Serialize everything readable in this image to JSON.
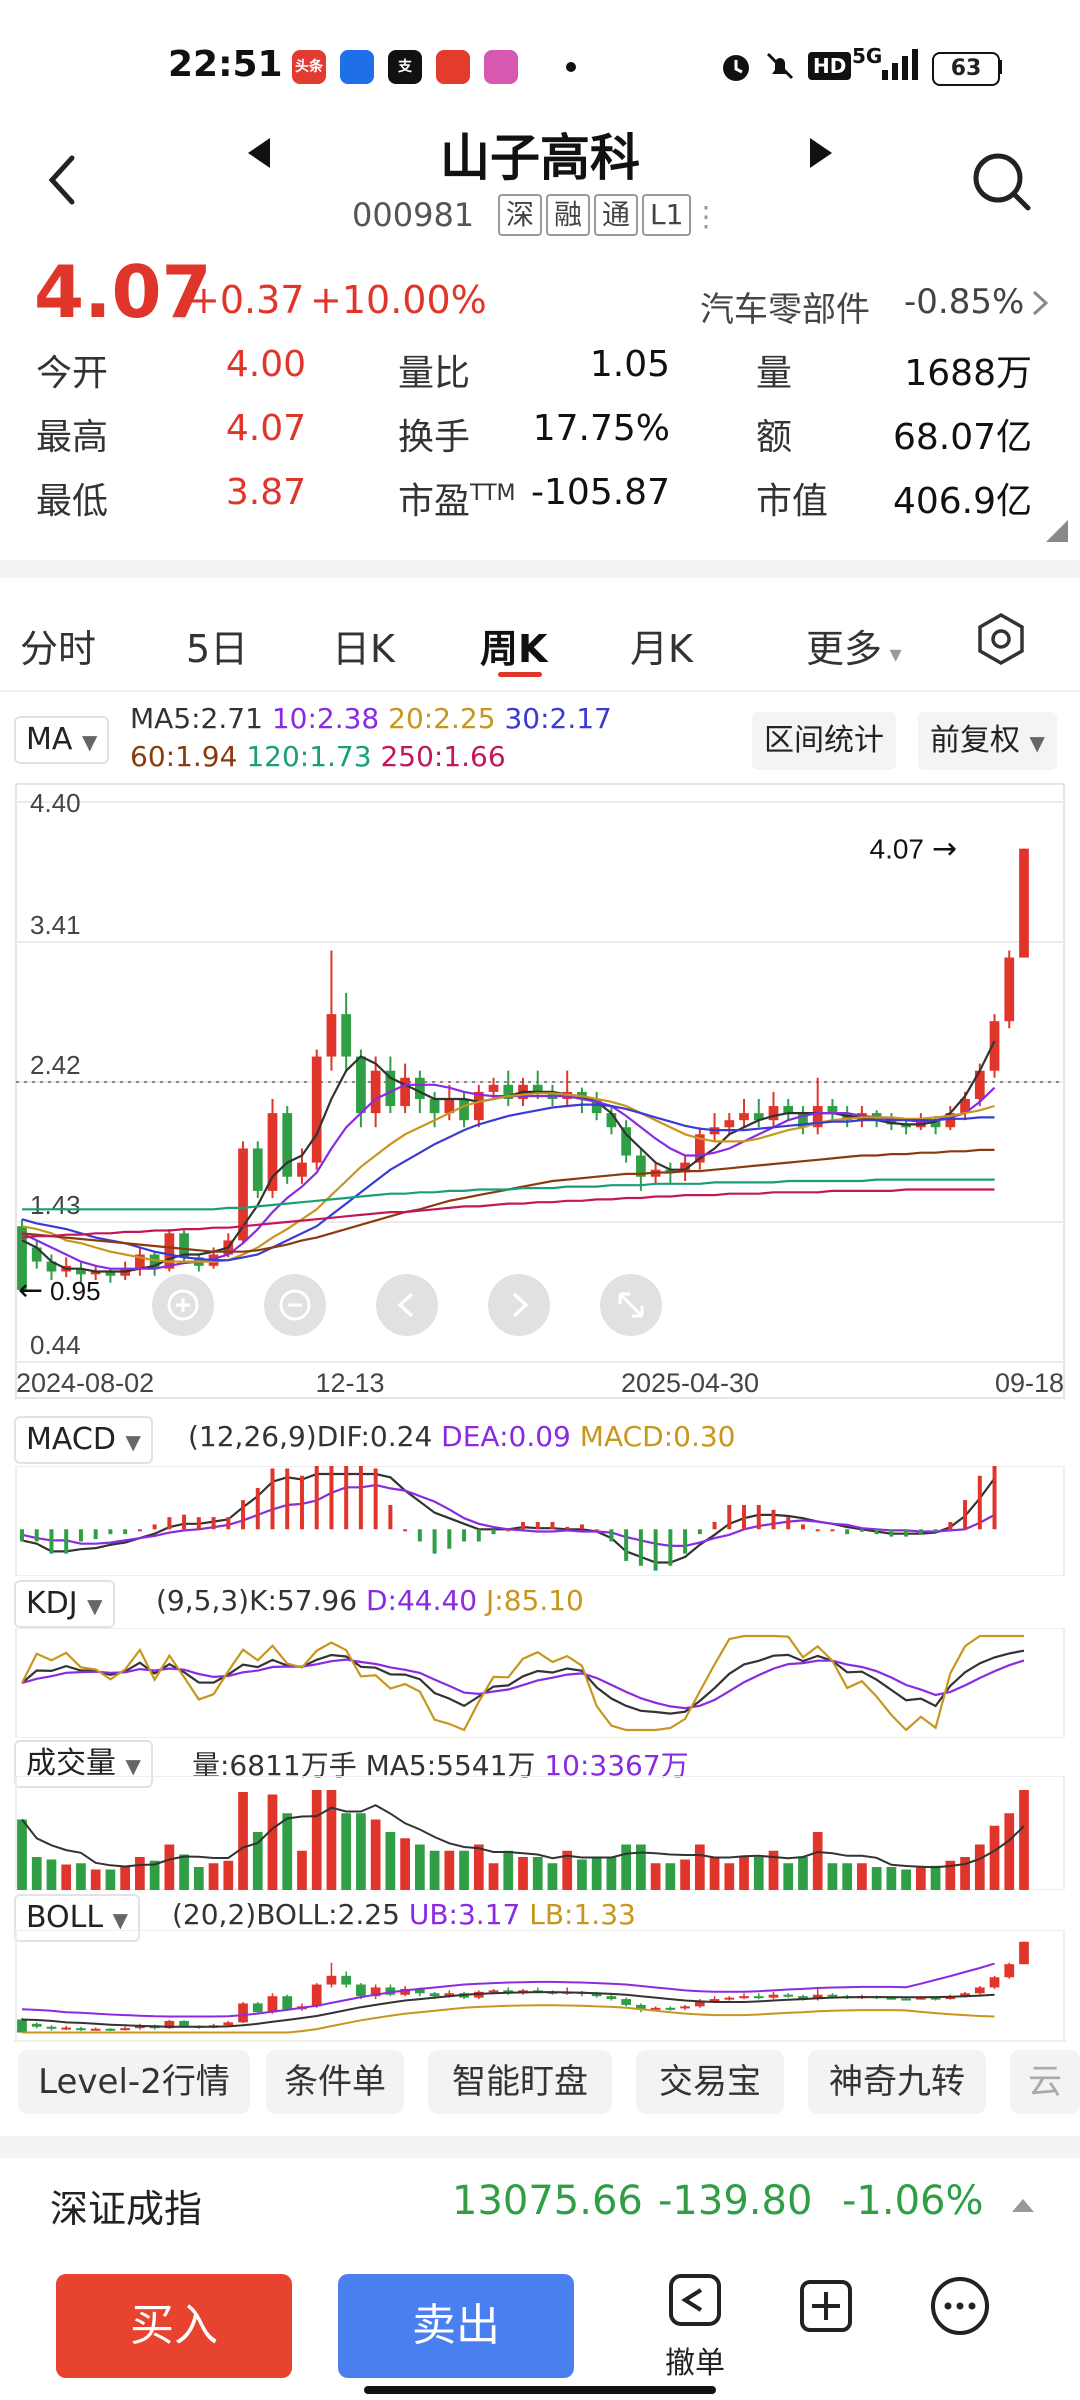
{
  "status_bar": {
    "time": "22:51",
    "apps": [
      {
        "name": "toutiao-app-icon",
        "color": "#e23b30",
        "label": "头条"
      },
      {
        "name": "blue-app-icon",
        "color": "#1e6fe8",
        "label": ""
      },
      {
        "name": "alipay-app-icon",
        "color": "#111111",
        "label": "支"
      },
      {
        "name": "red-envelope-app-icon",
        "color": "#e33b2e",
        "label": ""
      },
      {
        "name": "colorful-app-icon",
        "color": "#d85ab0",
        "label": ""
      }
    ],
    "right": {
      "hd": "HD",
      "net": "5G",
      "battery": "63"
    }
  },
  "header": {
    "title": "山子高科",
    "code": "000981",
    "tags": [
      "深",
      "融",
      "通",
      "L1"
    ]
  },
  "quote": {
    "price": "4.07",
    "change": "+0.37",
    "change_pct": "+10.00%",
    "sector": "汽车零部件",
    "sector_pct": "-0.85%",
    "rows": [
      [
        {
          "label": "今开",
          "value": "4.00",
          "tone": "red"
        },
        {
          "label": "量比",
          "value": "1.05",
          "tone": "dark"
        },
        {
          "label": "量",
          "value": "1688万",
          "tone": "dark"
        }
      ],
      [
        {
          "label": "最高",
          "value": "4.07",
          "tone": "red"
        },
        {
          "label": "换手",
          "value": "17.75%",
          "tone": "dark"
        },
        {
          "label": "额",
          "value": "68.07亿",
          "tone": "dark"
        }
      ],
      [
        {
          "label": "最低",
          "value": "3.87",
          "tone": "red"
        },
        {
          "label": "市盈TTM",
          "value": "-105.87",
          "tone": "dark"
        },
        {
          "label": "市值",
          "value": "406.9亿",
          "tone": "dark"
        }
      ]
    ]
  },
  "tabs": [
    "分时",
    "5日",
    "日K",
    "周K",
    "月K",
    "更多"
  ],
  "active_tab": "周K",
  "ma_panel": {
    "selector": "MA",
    "line1": [
      {
        "text": "MA5:2.71",
        "color": "#333333"
      },
      {
        "text": "10:2.38",
        "color": "#8a2be2"
      },
      {
        "text": "20:2.25",
        "color": "#c8961e"
      },
      {
        "text": "30:2.17",
        "color": "#3a3ad6"
      }
    ],
    "line2": [
      {
        "text": "60:1.94",
        "color": "#8b3a10"
      },
      {
        "text": "120:1.73",
        "color": "#1a9e7a"
      },
      {
        "text": "250:1.66",
        "color": "#c2185b"
      }
    ],
    "range_stats": "区间统计",
    "adjust": "前复权"
  },
  "chart_data": [
    {
      "type": "candlestick",
      "title": "周K",
      "y_ticks": [
        "4.40",
        "3.41",
        "2.42",
        "1.43",
        "0.44"
      ],
      "ylim": [
        0.44,
        4.4
      ],
      "x_ticks": [
        "2024-08-02",
        "12-13",
        "2025-04-30",
        "09-18"
      ],
      "max_label": "4.07",
      "min_label": "0.95",
      "dotted_ref": 2.42,
      "candles": [
        {
          "o": 1.4,
          "c": 0.95,
          "h": 1.45,
          "l": 0.95
        },
        {
          "o": 1.25,
          "c": 1.15,
          "h": 1.3,
          "l": 1.1
        },
        {
          "o": 1.15,
          "c": 1.08,
          "h": 1.2,
          "l": 1.02
        },
        {
          "o": 1.08,
          "c": 1.12,
          "h": 1.18,
          "l": 1.04
        },
        {
          "o": 1.1,
          "c": 1.06,
          "h": 1.15,
          "l": 1.0
        },
        {
          "o": 1.06,
          "c": 1.08,
          "h": 1.12,
          "l": 1.02
        },
        {
          "o": 1.08,
          "c": 1.05,
          "h": 1.1,
          "l": 1.0
        },
        {
          "o": 1.05,
          "c": 1.1,
          "h": 1.15,
          "l": 1.02
        },
        {
          "o": 1.1,
          "c": 1.2,
          "h": 1.25,
          "l": 1.05
        },
        {
          "o": 1.2,
          "c": 1.1,
          "h": 1.22,
          "l": 1.05
        },
        {
          "o": 1.1,
          "c": 1.35,
          "h": 1.38,
          "l": 1.08
        },
        {
          "o": 1.35,
          "c": 1.18,
          "h": 1.37,
          "l": 1.15
        },
        {
          "o": 1.18,
          "c": 1.12,
          "h": 1.2,
          "l": 1.08
        },
        {
          "o": 1.12,
          "c": 1.2,
          "h": 1.25,
          "l": 1.1
        },
        {
          "o": 1.2,
          "c": 1.3,
          "h": 1.35,
          "l": 1.18
        },
        {
          "o": 1.3,
          "c": 1.95,
          "h": 2.0,
          "l": 1.28
        },
        {
          "o": 1.95,
          "c": 1.65,
          "h": 2.0,
          "l": 1.6
        },
        {
          "o": 1.65,
          "c": 2.2,
          "h": 2.3,
          "l": 1.6
        },
        {
          "o": 2.2,
          "c": 1.75,
          "h": 2.25,
          "l": 1.7
        },
        {
          "o": 1.75,
          "c": 1.85,
          "h": 1.95,
          "l": 1.7
        },
        {
          "o": 1.85,
          "c": 2.6,
          "h": 2.65,
          "l": 1.8
        },
        {
          "o": 2.6,
          "c": 2.9,
          "h": 3.35,
          "l": 2.5
        },
        {
          "o": 2.9,
          "c": 2.6,
          "h": 3.05,
          "l": 2.5
        },
        {
          "o": 2.6,
          "c": 2.2,
          "h": 2.65,
          "l": 2.1
        },
        {
          "o": 2.2,
          "c": 2.5,
          "h": 2.6,
          "l": 2.1
        },
        {
          "o": 2.5,
          "c": 2.25,
          "h": 2.6,
          "l": 2.2
        },
        {
          "o": 2.25,
          "c": 2.45,
          "h": 2.55,
          "l": 2.2
        },
        {
          "o": 2.45,
          "c": 2.3,
          "h": 2.5,
          "l": 2.2
        },
        {
          "o": 2.3,
          "c": 2.2,
          "h": 2.35,
          "l": 2.1
        },
        {
          "o": 2.2,
          "c": 2.3,
          "h": 2.4,
          "l": 2.15
        },
        {
          "o": 2.3,
          "c": 2.15,
          "h": 2.35,
          "l": 2.1
        },
        {
          "o": 2.15,
          "c": 2.35,
          "h": 2.4,
          "l": 2.1
        },
        {
          "o": 2.35,
          "c": 2.4,
          "h": 2.45,
          "l": 2.3
        },
        {
          "o": 2.4,
          "c": 2.3,
          "h": 2.5,
          "l": 2.25
        },
        {
          "o": 2.3,
          "c": 2.4,
          "h": 2.45,
          "l": 2.25
        },
        {
          "o": 2.4,
          "c": 2.35,
          "h": 2.5,
          "l": 2.3
        },
        {
          "o": 2.35,
          "c": 2.3,
          "h": 2.4,
          "l": 2.25
        },
        {
          "o": 2.3,
          "c": 2.35,
          "h": 2.5,
          "l": 2.25
        },
        {
          "o": 2.35,
          "c": 2.3,
          "h": 2.38,
          "l": 2.2
        },
        {
          "o": 2.3,
          "c": 2.2,
          "h": 2.35,
          "l": 2.15
        },
        {
          "o": 2.2,
          "c": 2.1,
          "h": 2.25,
          "l": 2.05
        },
        {
          "o": 2.1,
          "c": 1.9,
          "h": 2.15,
          "l": 1.85
        },
        {
          "o": 1.9,
          "c": 1.75,
          "h": 1.95,
          "l": 1.65
        },
        {
          "o": 1.75,
          "c": 1.8,
          "h": 1.85,
          "l": 1.7
        },
        {
          "o": 1.8,
          "c": 1.78,
          "h": 1.85,
          "l": 1.7
        },
        {
          "o": 1.78,
          "c": 1.85,
          "h": 1.9,
          "l": 1.72
        },
        {
          "o": 1.85,
          "c": 2.05,
          "h": 2.1,
          "l": 1.8
        },
        {
          "o": 2.05,
          "c": 2.1,
          "h": 2.2,
          "l": 2.0
        },
        {
          "o": 2.1,
          "c": 2.15,
          "h": 2.2,
          "l": 2.05
        },
        {
          "o": 2.15,
          "c": 2.2,
          "h": 2.3,
          "l": 2.1
        },
        {
          "o": 2.2,
          "c": 2.15,
          "h": 2.3,
          "l": 2.1
        },
        {
          "o": 2.15,
          "c": 2.25,
          "h": 2.35,
          "l": 2.1
        },
        {
          "o": 2.25,
          "c": 2.2,
          "h": 2.3,
          "l": 2.15
        },
        {
          "o": 2.2,
          "c": 2.1,
          "h": 2.25,
          "l": 2.05
        },
        {
          "o": 2.1,
          "c": 2.25,
          "h": 2.45,
          "l": 2.05
        },
        {
          "o": 2.25,
          "c": 2.2,
          "h": 2.3,
          "l": 2.15
        },
        {
          "o": 2.2,
          "c": 2.15,
          "h": 2.25,
          "l": 2.1
        },
        {
          "o": 2.15,
          "c": 2.2,
          "h": 2.25,
          "l": 2.1
        },
        {
          "o": 2.2,
          "c": 2.15,
          "h": 2.22,
          "l": 2.1
        },
        {
          "o": 2.15,
          "c": 2.12,
          "h": 2.2,
          "l": 2.08
        },
        {
          "o": 2.12,
          "c": 2.1,
          "h": 2.15,
          "l": 2.05
        },
        {
          "o": 2.1,
          "c": 2.15,
          "h": 2.2,
          "l": 2.08
        },
        {
          "o": 2.15,
          "c": 2.1,
          "h": 2.18,
          "l": 2.05
        },
        {
          "o": 2.1,
          "c": 2.2,
          "h": 2.25,
          "l": 2.08
        },
        {
          "o": 2.2,
          "c": 2.3,
          "h": 2.35,
          "l": 2.15
        },
        {
          "o": 2.3,
          "c": 2.5,
          "h": 2.55,
          "l": 2.25
        },
        {
          "o": 2.5,
          "c": 2.85,
          "h": 2.9,
          "l": 2.45
        },
        {
          "o": 2.85,
          "c": 3.3,
          "h": 3.35,
          "l": 2.8
        },
        {
          "o": 3.3,
          "c": 4.07,
          "h": 4.07,
          "l": 3.3
        }
      ],
      "ma_lines": [
        {
          "name": "MA5",
          "color": "#333333",
          "values": [
            1.3,
            1.25,
            1.15,
            1.1,
            1.1,
            1.08,
            1.08,
            1.08,
            1.1,
            1.12,
            1.17,
            1.2,
            1.2,
            1.22,
            1.25,
            1.4,
            1.55,
            1.75,
            1.85,
            1.9,
            2.05,
            2.3,
            2.5,
            2.6,
            2.55,
            2.45,
            2.4,
            2.35,
            2.3,
            2.3,
            2.3,
            2.28,
            2.3,
            2.32,
            2.35,
            2.35,
            2.35,
            2.33,
            2.32,
            2.28,
            2.2,
            2.05,
            1.95,
            1.85,
            1.8,
            1.8,
            1.88,
            1.95,
            2.05,
            2.1,
            2.15,
            2.18,
            2.2,
            2.2,
            2.2,
            2.2,
            2.18,
            2.17,
            2.15,
            2.13,
            2.12,
            2.12,
            2.14,
            2.2,
            2.32,
            2.5,
            2.71
          ]
        },
        {
          "name": "MA10",
          "color": "#8a2be2",
          "values": [
            1.35,
            1.3,
            1.25,
            1.2,
            1.15,
            1.12,
            1.1,
            1.1,
            1.1,
            1.1,
            1.12,
            1.14,
            1.15,
            1.17,
            1.2,
            1.28,
            1.38,
            1.5,
            1.6,
            1.68,
            1.78,
            1.95,
            2.1,
            2.2,
            2.3,
            2.35,
            2.4,
            2.4,
            2.4,
            2.38,
            2.35,
            2.33,
            2.32,
            2.32,
            2.32,
            2.32,
            2.32,
            2.32,
            2.3,
            2.28,
            2.25,
            2.18,
            2.1,
            2.02,
            1.95,
            1.9,
            1.9,
            1.92,
            1.95,
            2.0,
            2.05,
            2.1,
            2.15,
            2.18,
            2.2,
            2.2,
            2.2,
            2.18,
            2.17,
            2.16,
            2.15,
            2.14,
            2.15,
            2.17,
            2.2,
            2.28,
            2.38
          ]
        },
        {
          "name": "MA20",
          "color": "#c8961e",
          "values": [
            1.4,
            1.38,
            1.35,
            1.3,
            1.28,
            1.25,
            1.22,
            1.2,
            1.18,
            1.16,
            1.15,
            1.15,
            1.15,
            1.15,
            1.16,
            1.2,
            1.25,
            1.32,
            1.38,
            1.45,
            1.52,
            1.62,
            1.72,
            1.82,
            1.9,
            1.98,
            2.05,
            2.1,
            2.15,
            2.2,
            2.25,
            2.28,
            2.3,
            2.32,
            2.33,
            2.34,
            2.34,
            2.33,
            2.32,
            2.3,
            2.28,
            2.25,
            2.2,
            2.15,
            2.1,
            2.05,
            2.02,
            2.0,
            2.0,
            2.0,
            2.02,
            2.05,
            2.08,
            2.1,
            2.13,
            2.15,
            2.16,
            2.17,
            2.17,
            2.17,
            2.16,
            2.16,
            2.17,
            2.18,
            2.2,
            2.22,
            2.25
          ]
        },
        {
          "name": "MA30",
          "color": "#3a3ad6",
          "values": [
            1.45,
            1.42,
            1.4,
            1.38,
            1.35,
            1.32,
            1.3,
            1.28,
            1.25,
            1.22,
            1.2,
            1.18,
            1.17,
            1.16,
            1.16,
            1.18,
            1.2,
            1.25,
            1.3,
            1.35,
            1.4,
            1.48,
            1.56,
            1.64,
            1.72,
            1.8,
            1.86,
            1.92,
            1.98,
            2.03,
            2.08,
            2.12,
            2.15,
            2.18,
            2.2,
            2.22,
            2.24,
            2.25,
            2.26,
            2.26,
            2.25,
            2.23,
            2.2,
            2.17,
            2.14,
            2.11,
            2.09,
            2.08,
            2.08,
            2.08,
            2.09,
            2.1,
            2.11,
            2.12,
            2.13,
            2.14,
            2.14,
            2.15,
            2.15,
            2.15,
            2.15,
            2.15,
            2.15,
            2.16,
            2.16,
            2.17,
            2.17
          ]
        },
        {
          "name": "MA60",
          "color": "#8b3a10",
          "values": [
            1.35,
            1.34,
            1.33,
            1.32,
            1.31,
            1.3,
            1.29,
            1.28,
            1.27,
            1.26,
            1.25,
            1.24,
            1.23,
            1.22,
            1.22,
            1.22,
            1.23,
            1.25,
            1.27,
            1.3,
            1.32,
            1.35,
            1.38,
            1.41,
            1.44,
            1.47,
            1.5,
            1.52,
            1.55,
            1.58,
            1.6,
            1.62,
            1.64,
            1.66,
            1.68,
            1.7,
            1.72,
            1.73,
            1.74,
            1.75,
            1.76,
            1.77,
            1.77,
            1.78,
            1.78,
            1.79,
            1.79,
            1.8,
            1.81,
            1.82,
            1.83,
            1.84,
            1.85,
            1.86,
            1.87,
            1.88,
            1.89,
            1.9,
            1.9,
            1.91,
            1.91,
            1.92,
            1.92,
            1.93,
            1.93,
            1.94,
            1.94
          ]
        },
        {
          "name": "MA120",
          "color": "#1a9e7a",
          "values": [
            1.52,
            1.52,
            1.52,
            1.52,
            1.52,
            1.52,
            1.52,
            1.52,
            1.52,
            1.52,
            1.52,
            1.52,
            1.52,
            1.52,
            1.53,
            1.53,
            1.54,
            1.55,
            1.56,
            1.57,
            1.58,
            1.59,
            1.6,
            1.61,
            1.62,
            1.63,
            1.63,
            1.64,
            1.64,
            1.65,
            1.65,
            1.66,
            1.66,
            1.66,
            1.67,
            1.67,
            1.67,
            1.68,
            1.68,
            1.68,
            1.69,
            1.69,
            1.69,
            1.7,
            1.7,
            1.7,
            1.7,
            1.71,
            1.71,
            1.71,
            1.71,
            1.71,
            1.72,
            1.72,
            1.72,
            1.72,
            1.72,
            1.72,
            1.73,
            1.73,
            1.73,
            1.73,
            1.73,
            1.73,
            1.73,
            1.73,
            1.73
          ]
        },
        {
          "name": "MA250",
          "color": "#c2185b",
          "values": [
            1.32,
            1.33,
            1.33,
            1.34,
            1.34,
            1.35,
            1.35,
            1.36,
            1.36,
            1.37,
            1.37,
            1.38,
            1.38,
            1.39,
            1.39,
            1.4,
            1.41,
            1.42,
            1.43,
            1.44,
            1.45,
            1.46,
            1.47,
            1.48,
            1.49,
            1.5,
            1.5,
            1.51,
            1.52,
            1.53,
            1.54,
            1.54,
            1.55,
            1.56,
            1.56,
            1.57,
            1.57,
            1.58,
            1.58,
            1.59,
            1.59,
            1.6,
            1.6,
            1.61,
            1.61,
            1.62,
            1.62,
            1.62,
            1.63,
            1.63,
            1.63,
            1.64,
            1.64,
            1.64,
            1.64,
            1.65,
            1.65,
            1.65,
            1.65,
            1.65,
            1.66,
            1.66,
            1.66,
            1.66,
            1.66,
            1.66,
            1.66
          ]
        }
      ]
    }
  ],
  "macd": {
    "selector": "MACD",
    "params": "(12,26,9)",
    "dif": "DIF:0.24",
    "dea": "DEA:0.09",
    "macd": "MACD:0.30"
  },
  "kdj": {
    "selector": "KDJ",
    "params": "(9,5,3)K:57.96",
    "d": "D:44.40",
    "j": "J:85.10"
  },
  "volume": {
    "selector": "成交量",
    "text": "量:6811万手 MA5:5541万",
    "ma10": "10:3367万"
  },
  "boll": {
    "selector": "BOLL",
    "params": "(20,2)BOLL:2.25",
    "ub": "UB:3.17",
    "lb": "LB:1.33"
  },
  "chips": [
    "Level-2行情",
    "条件单",
    "智能盯盘",
    "交易宝",
    "神奇九转",
    "云"
  ],
  "index_bar": {
    "name": "深证成指",
    "value": "13075.66",
    "change": "-139.80",
    "pct": "-1.06%"
  },
  "actions": {
    "buy": "买入",
    "sell": "卖出",
    "cancel": "撤单"
  }
}
